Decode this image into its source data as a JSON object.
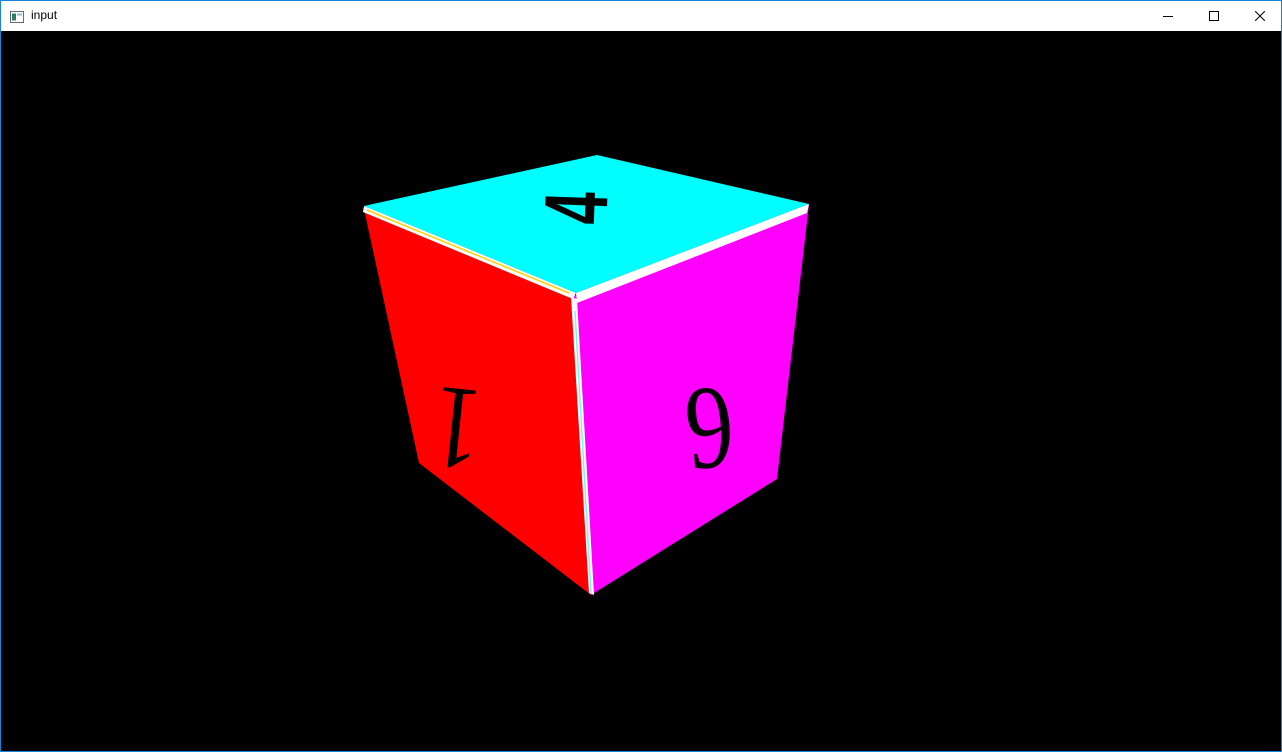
{
  "window": {
    "title": "input",
    "controls": {
      "minimize_icon": "minimize-icon",
      "maximize_icon": "maximize-icon",
      "close_icon": "close-icon"
    }
  },
  "scene": {
    "background_color": "#000000",
    "cube": {
      "top_face": {
        "color": "#00ffff",
        "glyph": "4"
      },
      "left_face": {
        "color": "#ff0000",
        "glyph": "1"
      },
      "right_face": {
        "color": "#ff00ff",
        "glyph": "6"
      },
      "edge_color": "#ffffff"
    }
  }
}
